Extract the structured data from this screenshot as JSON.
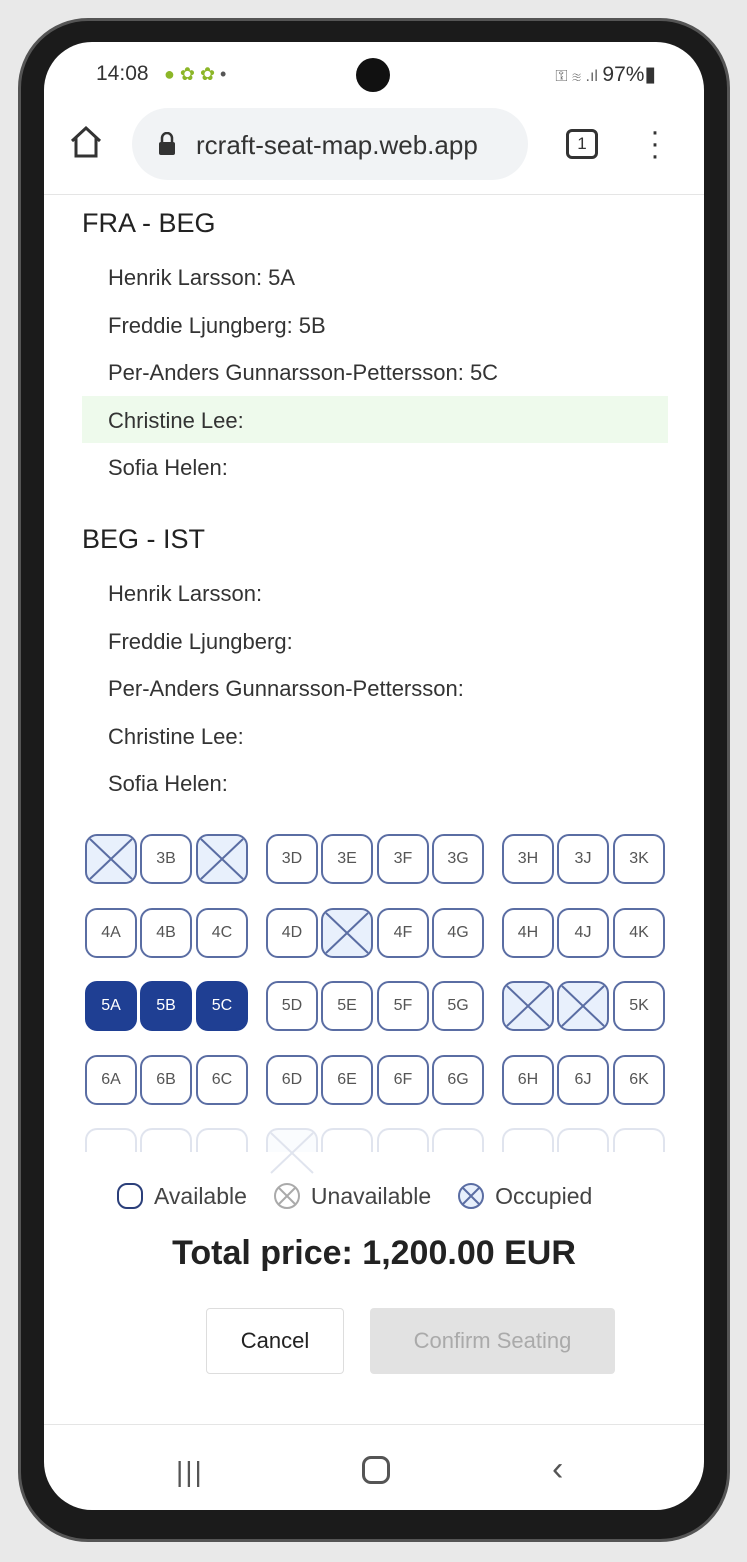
{
  "status_bar": {
    "time": "14:08",
    "battery": "97%"
  },
  "browser": {
    "url": "rcraft-seat-map.web.app",
    "tab_count": "1"
  },
  "segments": [
    {
      "title": "FRA - BEG",
      "passengers": [
        "Henrik Larsson: 5A",
        "Freddie Ljungberg: 5B",
        "Per-Anders Gunnarsson-Pettersson: 5C",
        "Christine Lee:",
        "Sofia Helen:"
      ],
      "active_index": 3
    },
    {
      "title": "BEG - IST",
      "passengers": [
        "Henrik Larsson:",
        "Freddie Ljungberg:",
        "Per-Anders Gunnarsson-Pettersson:",
        "Christine Lee:",
        "Sofia Helen:"
      ]
    }
  ],
  "seat_map": {
    "columns": [
      "A",
      "B",
      "C",
      "D",
      "E",
      "F",
      "G",
      "H",
      "J",
      "K"
    ],
    "rows": [
      {
        "row": "3",
        "occupied": [
          "3A",
          "3C"
        ],
        "selected": []
      },
      {
        "row": "4",
        "occupied": [
          "4E"
        ],
        "selected": []
      },
      {
        "row": "5",
        "occupied": [
          "5H",
          "5J"
        ],
        "selected": [
          "5A",
          "5B",
          "5C"
        ]
      },
      {
        "row": "6",
        "occupied": [],
        "selected": []
      },
      {
        "row": "7",
        "occupied": [
          "7D"
        ],
        "selected": [],
        "faded": true
      }
    ],
    "colors": {
      "selected": "#1f3f93",
      "border": "#5a6da3",
      "occupied_fill": "#e8f0fc"
    }
  },
  "legend": {
    "available": "Available",
    "unavailable": "Unavailable",
    "occupied": "Occupied"
  },
  "total_price": "Total price: 1,200.00 EUR",
  "buttons": {
    "cancel": "Cancel",
    "confirm": "Confirm Seating"
  }
}
